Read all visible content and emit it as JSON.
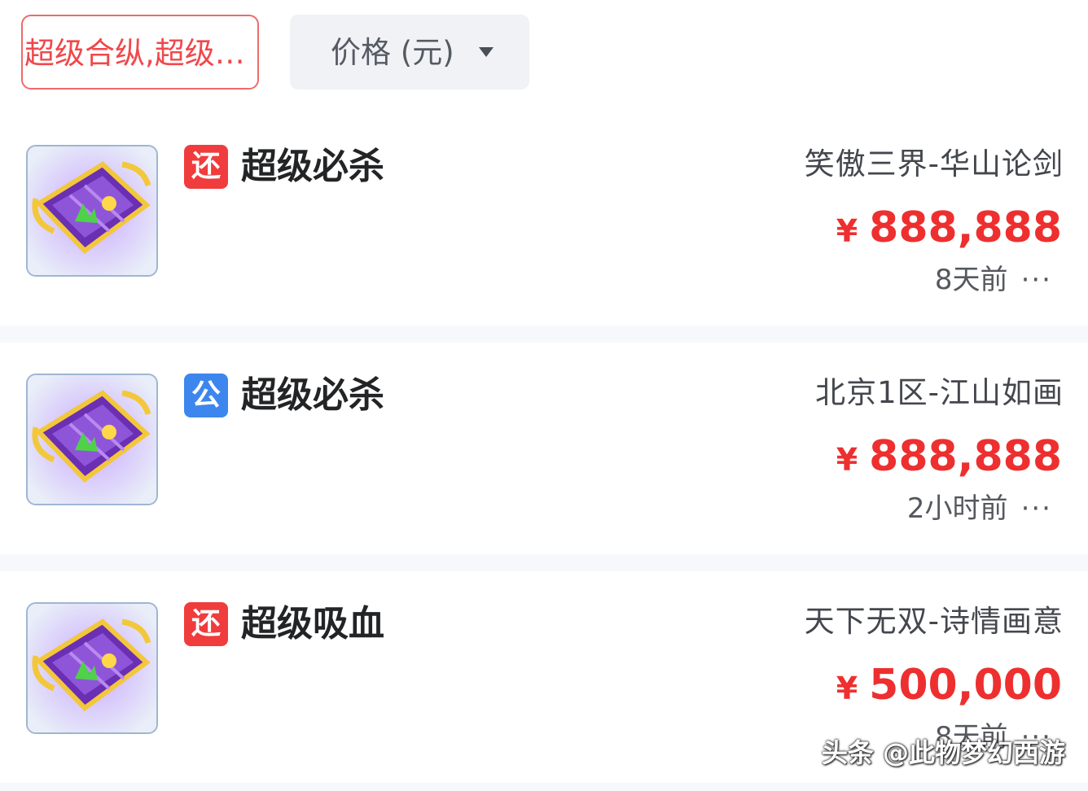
{
  "filters": {
    "active_chip": "超级合纵,超级…",
    "price_sort_label": "价格 (元)"
  },
  "colors": {
    "accent": "#ee2f2f",
    "badge_return": "#f03c3c",
    "badge_public": "#3d86ee"
  },
  "items": [
    {
      "badge": "还",
      "badge_type": "return",
      "title": "超级必杀",
      "server": "笑傲三界-华山论剑",
      "currency": "¥",
      "price": "888,888",
      "time": "8天前",
      "more": "···",
      "icon": "skill-book-scroll-icon"
    },
    {
      "badge": "公",
      "badge_type": "public",
      "title": "超级必杀",
      "server": "北京1区-江山如画",
      "currency": "¥",
      "price": "888,888",
      "time": "2小时前",
      "more": "···",
      "icon": "skill-book-scroll-icon"
    },
    {
      "badge": "还",
      "badge_type": "return",
      "title": "超级吸血",
      "server": "天下无双-诗情画意",
      "currency": "¥",
      "price": "500,000",
      "time": "8天前",
      "more": "···",
      "icon": "skill-book-scroll-icon"
    }
  ],
  "watermark": "头条 @此物梦幻西游"
}
